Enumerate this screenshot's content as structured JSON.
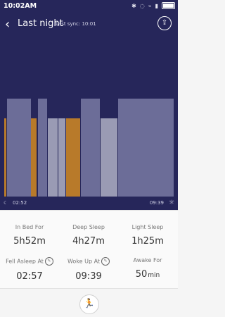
{
  "status": {
    "time": "10:02AM",
    "battery": "battery"
  },
  "header": {
    "title": "Last night",
    "sync": "Last sync: 10:01"
  },
  "chart_data": {
    "type": "bar",
    "start": "02:52",
    "end": "09:39"
  },
  "stats": [
    {
      "label": "In Bed For",
      "value": "5h52m",
      "unit": ""
    },
    {
      "label": "Deep Sleep",
      "value": "4h27m",
      "unit": ""
    },
    {
      "label": "Light Sleep",
      "value": "1h25m",
      "unit": ""
    },
    {
      "label": "Fell Asleep At",
      "value": "02:57",
      "unit": ""
    },
    {
      "label": "Woke Up At",
      "value": "09:39",
      "unit": ""
    },
    {
      "label": "Awake For",
      "value": "50",
      "unit": "min"
    }
  ]
}
